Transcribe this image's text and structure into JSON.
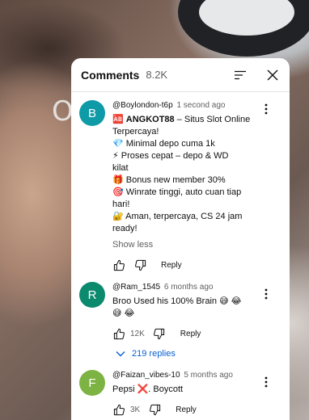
{
  "video": {
    "overlay_letter": "O"
  },
  "panel": {
    "title": "Comments",
    "count": "8.2K",
    "icons": [
      "sort-icon",
      "close-icon"
    ]
  },
  "comments": [
    {
      "avatar_letter": "B",
      "avatar_color": "#0e9aa7",
      "handle": "@Boylondon-t6p",
      "time": "1 second ago",
      "lines": [
        "🆎 ANGKOT88 – Situs Slot Online",
        "Terpercaya!",
        "💎 Minimal depo cuma 1k",
        "⚡ Proses cepat – depo & WD",
        "kilat",
        "🎁 Bonus new member 30%",
        "🎯 Winrate tinggi, auto cuan tiap",
        "hari!",
        "🔐 Aman, terpercaya, CS 24 jam",
        "ready!"
      ],
      "show_less": "Show less",
      "like_count": "",
      "reply_label": "Reply"
    },
    {
      "avatar_letter": "R",
      "avatar_color": "#0b8a6e",
      "handle": "@Ram_1545",
      "time": "6 months ago",
      "lines": [
        "Broo Used his 100% Brain 😅 😂",
        "😅 😂"
      ],
      "like_count": "12K",
      "reply_label": "Reply",
      "replies_label": "219 replies"
    },
    {
      "avatar_letter": "F",
      "avatar_color": "#7cb342",
      "handle": "@Faizan_vibes-10",
      "time": "5 months ago",
      "lines": [
        "Pepsi ❌.  Boycott"
      ],
      "like_count": "3K",
      "reply_label": "Reply"
    }
  ]
}
